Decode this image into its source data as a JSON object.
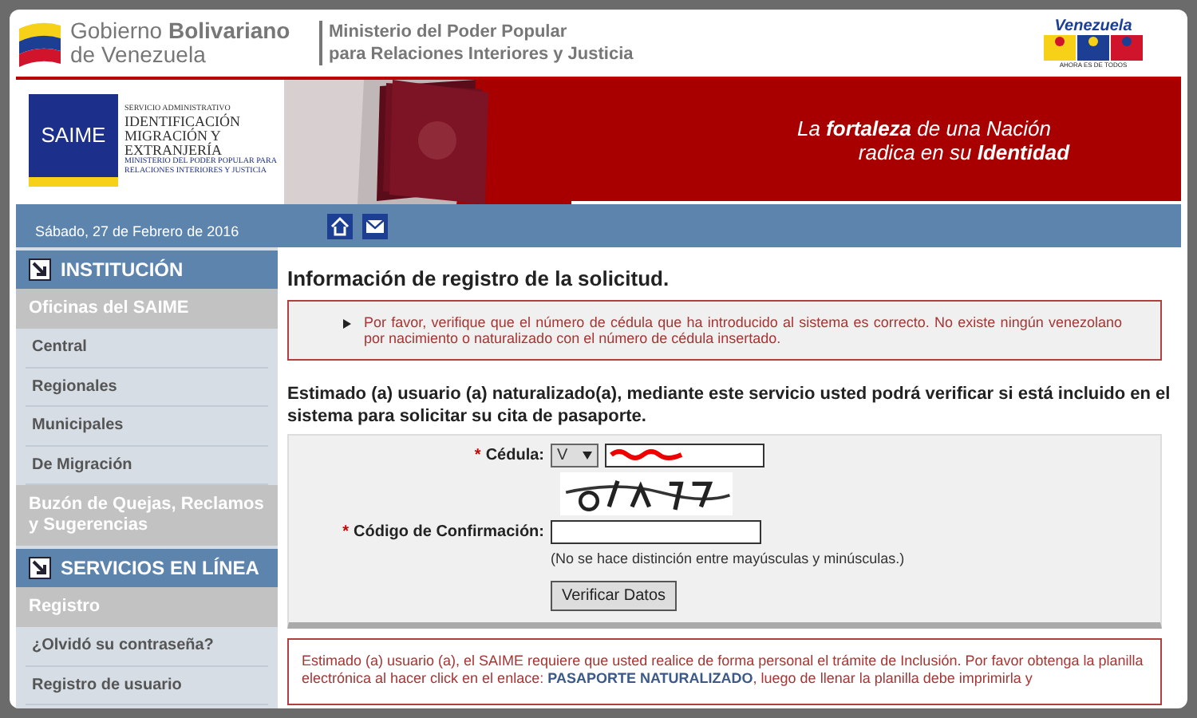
{
  "header": {
    "gov_lines": [
      "Gobierno **Bolivariano**",
      "de Venezuela"
    ],
    "ministry_lines": [
      "Ministerio del Poder Popular",
      "para **Relaciones Interiores y Justicia**"
    ],
    "campaign_logo": {
      "title": "Venezuela",
      "tagline": "AHORA ES DE TODOS"
    }
  },
  "banner": {
    "saime": "SAIME",
    "service_lines": [
      "SERVICIO ADMINISTRATIVO",
      "IDENTIFICACIÓN",
      "MIGRACIÓN Y",
      "EXTRANJERÍA"
    ],
    "ministry_lines": [
      "MINISTERIO DEL PODER POPULAR PARA",
      "RELACIONES INTERIORES Y JUSTICIA"
    ],
    "slogan": [
      "La **fortaleza** de una Nación",
      "radica en su **Identidad**"
    ]
  },
  "date": "Sábado, 27 de Febrero de 2016",
  "sidebar": {
    "items": [
      {
        "kind": "section",
        "label": "INSTITUCIÓN"
      },
      {
        "kind": "group",
        "label": "Oficinas del SAIME"
      },
      {
        "kind": "link",
        "label": "Central"
      },
      {
        "kind": "link",
        "label": "Regionales"
      },
      {
        "kind": "link",
        "label": "Municipales"
      },
      {
        "kind": "link",
        "label": "De Migración"
      },
      {
        "kind": "group",
        "label": "Buzón de Quejas, Reclamos y Sugerencias"
      },
      {
        "kind": "section",
        "label": "SERVICIOS EN LÍNEA"
      },
      {
        "kind": "group",
        "label": "Registro"
      },
      {
        "kind": "link",
        "label": "¿Olvidó su contraseña?"
      },
      {
        "kind": "link",
        "label": "Registro de usuario"
      }
    ]
  },
  "content": {
    "title": "Información de registro de la solicitud.",
    "alert": "Por favor, verifique que el número de cédula que ha introducido al sistema es correcto. No existe ningún venezolano por nacimiento o naturalizado con el número de cédula insertado.",
    "intro": "Estimado (a) usuario (a) naturalizado(a), mediante este servicio usted podrá verificar si está incluido en el sistema para solicitar su cita de pasaporte.",
    "form": {
      "required_mark": "*",
      "cedula_label": "Cédula:",
      "nationality": "V",
      "confirm_label": "Código de Confirmación:",
      "hint": "(No se hace distinción entre mayúsculas y minúsculas.)",
      "button": "Verificar Datos"
    },
    "notice": {
      "before": "Estimado (a) usuario (a), el SAIME requiere que usted realice de forma personal el trámite de Inclusión. Por favor obtenga la planilla electrónica al hacer click en el enlace:",
      "link": "PASAPORTE NATURALIZADO",
      "after": ", luego de llenar la planilla debe imprimirla y"
    }
  }
}
